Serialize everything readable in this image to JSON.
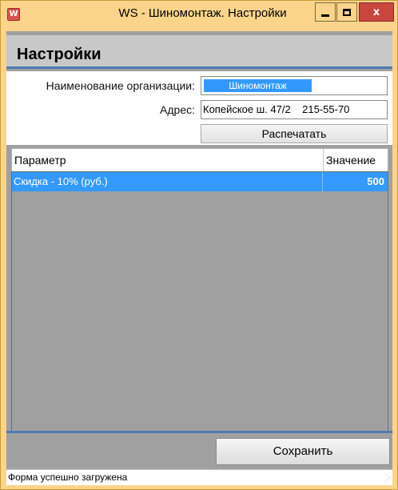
{
  "window": {
    "title": "WS - Шиномонтаж. Настройки",
    "close_label": "x"
  },
  "header": {
    "title": "Настройки"
  },
  "form": {
    "org_label": "Наименование организации:",
    "org_value": "Шиномонтаж",
    "address_label": "Адрес:",
    "address_value": "Копейское ш. 47/2    215-55-70",
    "print_button": "Распечатать"
  },
  "grid": {
    "columns": [
      "Параметр",
      "Значение"
    ],
    "rows": [
      {
        "param": "Скидка - 10% (руб.)",
        "value": "500"
      }
    ]
  },
  "footer": {
    "save_button": "Сохранить"
  },
  "status": {
    "text": "Форма успешно загружена"
  },
  "colors": {
    "frame": "#fbd48b",
    "accent": "#4f7bb5",
    "selection": "#3399ff",
    "close": "#c7463e"
  }
}
